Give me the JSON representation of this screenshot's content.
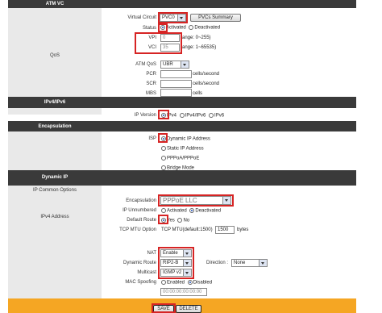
{
  "sections": {
    "atm_vc": "ATM VC",
    "qos": "QoS",
    "ipv4ipv6": "IPv4/IPv6",
    "encapsulation": "Encapsulation",
    "dynamic_ip": "Dynamic IP",
    "ip_common": "IP Common Options",
    "ipv4_address": "IPv4 Address"
  },
  "atm": {
    "vc_label": "Virtual Circuit",
    "vc_value": "PVC0",
    "pvcs_button": "PVCs Summary",
    "status_label": "Status",
    "status_activated": "Activated",
    "status_deactivated": "Deactivated",
    "vpi_label": "VPI",
    "vpi_value": "0",
    "vpi_range": "range: 0~255)",
    "vci_label": "VCI",
    "vci_value": "35",
    "vci_range": "range: 1~65535)"
  },
  "qos": {
    "atm_qos_label": "ATM QoS",
    "atm_qos_value": "UBR",
    "pcr_label": "PCR",
    "pcr_unit": "cells/second",
    "scr_label": "SCR",
    "scr_unit": "cells/second",
    "mbs_label": "MBS",
    "mbs_unit": "cells"
  },
  "ipver": {
    "label": "IP Version",
    "opt1": "IPv4",
    "opt2": "IPv4/IPv6",
    "opt3": "IPv6"
  },
  "isp": {
    "label": "ISP",
    "opt1": "Dynamic IP Address",
    "opt2": "Static IP Address",
    "opt3": "PPPoA/PPPoE",
    "opt4": "Bridge Mode"
  },
  "common": {
    "encap_label": "Encapsulation",
    "encap_value": "PPPoE LLC",
    "unnumbered_label": "IP Unnumbered",
    "unnumbered_activated": "Activated",
    "unnumbered_deactivated": "Deactivated",
    "default_route_label": "Default Route",
    "default_route_yes": "Yes",
    "default_route_no": "No",
    "mtu_label": "TCP MTU Option",
    "mtu_caption": "TCP MTU(default:1500)",
    "mtu_value": "1500",
    "mtu_unit": "bytes"
  },
  "ipv4": {
    "nat_label": "NAT",
    "nat_value": "Enable",
    "dynroute_label": "Dynamic Route",
    "dynroute_value": "RIP2-B",
    "direction_label": "Direction :",
    "direction_value": "None",
    "multicast_label": "Multicast",
    "multicast_value": "IGMP v2",
    "mac_label": "MAC Spoofing",
    "mac_enabled": "Enabled",
    "mac_disabled": "Disabled",
    "mac_value": "00:00:00:00:00:00"
  },
  "footer": {
    "save": "SAVE",
    "delete": "DELETE"
  },
  "colors": {
    "header_bg": "#3a3a3a",
    "highlight": "#d62424",
    "footer_bg": "#f5a623"
  }
}
